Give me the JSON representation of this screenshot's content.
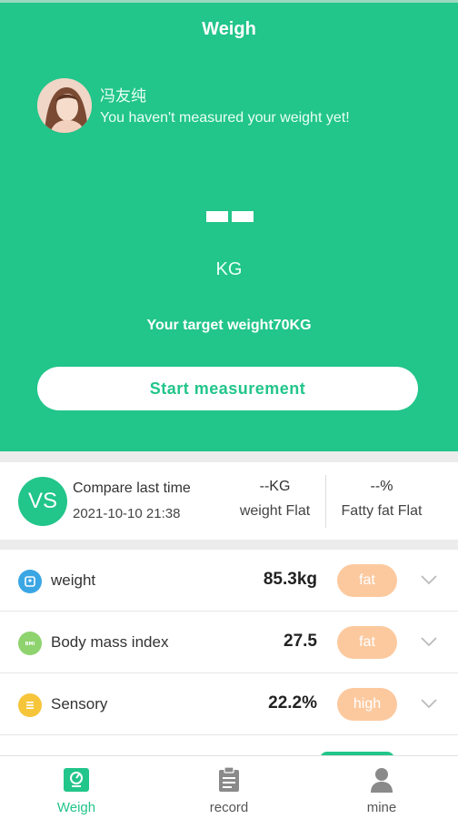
{
  "header": {
    "title": "Weigh"
  },
  "user": {
    "name": "冯友纯",
    "status": "You haven't measured your weight yet!"
  },
  "weight": {
    "value": "--",
    "unit": "KG",
    "target_text": "Your target weight70KG",
    "start_button": "Start measurement"
  },
  "compare": {
    "vs_label": "VS",
    "title": "Compare last time",
    "date": "2021-10-10 21:38",
    "columns": [
      {
        "value": "--KG",
        "label": "weight Flat"
      },
      {
        "value": "--%",
        "label": "Fatty fat Flat"
      }
    ]
  },
  "metrics": [
    {
      "name": "weight",
      "value": "85.3kg",
      "tag": "fat",
      "icon": "scale-icon",
      "color": "#3aa6e4"
    },
    {
      "name": "Body mass index",
      "value": "27.5",
      "tag": "fat",
      "icon": "bmi-icon",
      "color": "#8fd36f"
    },
    {
      "name": "Sensory",
      "value": "22.2%",
      "tag": "high",
      "icon": "sensory-icon",
      "color": "#f6c53a"
    }
  ],
  "tabs": [
    {
      "label": "Weigh",
      "icon": "weigh-tab-icon",
      "active": true
    },
    {
      "label": "record",
      "icon": "clipboard-icon",
      "active": false
    },
    {
      "label": "mine",
      "icon": "person-icon",
      "active": false
    }
  ],
  "colors": {
    "accent": "#22c58a",
    "tag": "#fcc99f"
  }
}
